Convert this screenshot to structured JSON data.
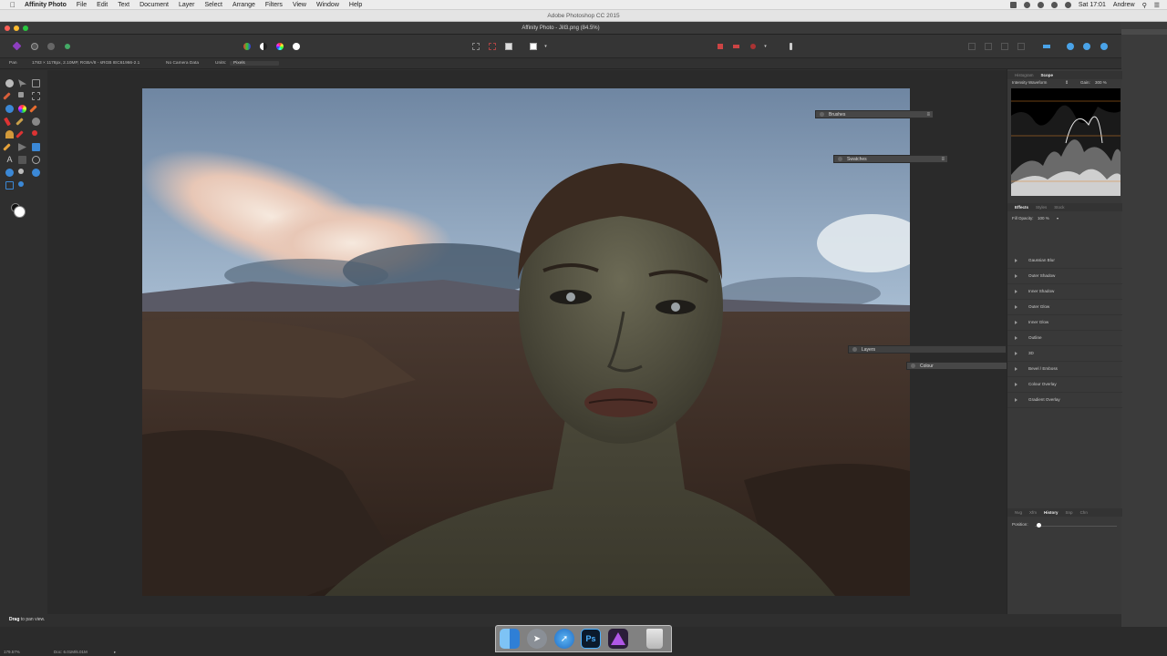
{
  "menubar": {
    "apple_icon": "apple-icon",
    "items": [
      "Affinity Photo",
      "File",
      "Edit",
      "Text",
      "Document",
      "Layer",
      "Select",
      "Arrange",
      "Filters",
      "View",
      "Window",
      "Help"
    ],
    "clock": "Sat 17:01",
    "user": "Andrew"
  },
  "titlebar": {
    "title": "Adobe Photoshop CC 2015"
  },
  "document": {
    "title": "Affinity Photo - Jill3.png (84.5%)"
  },
  "context_bar": {
    "tool": "Pan",
    "doc_info": "1783 × 1178px, 2.10MP, RGBA/8 - sRGB IEC61966-2.1",
    "camera": "No Camera Data",
    "units_label": "Units:",
    "units_value": "Pixels"
  },
  "floating_panels": {
    "brushes": "Brushes",
    "swatches": "Swatches",
    "layers": "Layers",
    "colour": "Colour"
  },
  "studio": {
    "top_tabs": [
      "Histogram",
      "Scope"
    ],
    "active_top_tab": "Scope",
    "scope_mode": "Intensity Waveform",
    "gain_label": "Gain:",
    "gain_value": "300 %",
    "fx_tabs": [
      "Effects",
      "Styles",
      "Stock"
    ],
    "active_fx_tab": "Effects",
    "fill_opacity_label": "Fill Opacity:",
    "fill_opacity_value": "100 %",
    "effects": [
      "Gaussian Blur",
      "Outer Shadow",
      "Inner Shadow",
      "Outer Glow",
      "Inner Glow",
      "Outline",
      "3D",
      "Bevel / Emboss",
      "Colour Overlay",
      "Gradient Overlay"
    ],
    "bottom_tabs": [
      "Nvg",
      "Xfm",
      "History",
      "Snp",
      "Chn"
    ],
    "active_bottom_tab": "History",
    "position_label": "Position:"
  },
  "status": {
    "hint_bold": "Drag",
    "hint_rest": " to pan view.",
    "zoom": "179.57%",
    "doc_size": "Doc: 6.01M/6.01M"
  },
  "dock": {
    "photoshop_label": "Ps",
    "items": [
      "finder-icon",
      "launchpad-icon",
      "safari-icon",
      "photoshop-icon",
      "affinity-photo-icon",
      "trash-icon"
    ]
  }
}
